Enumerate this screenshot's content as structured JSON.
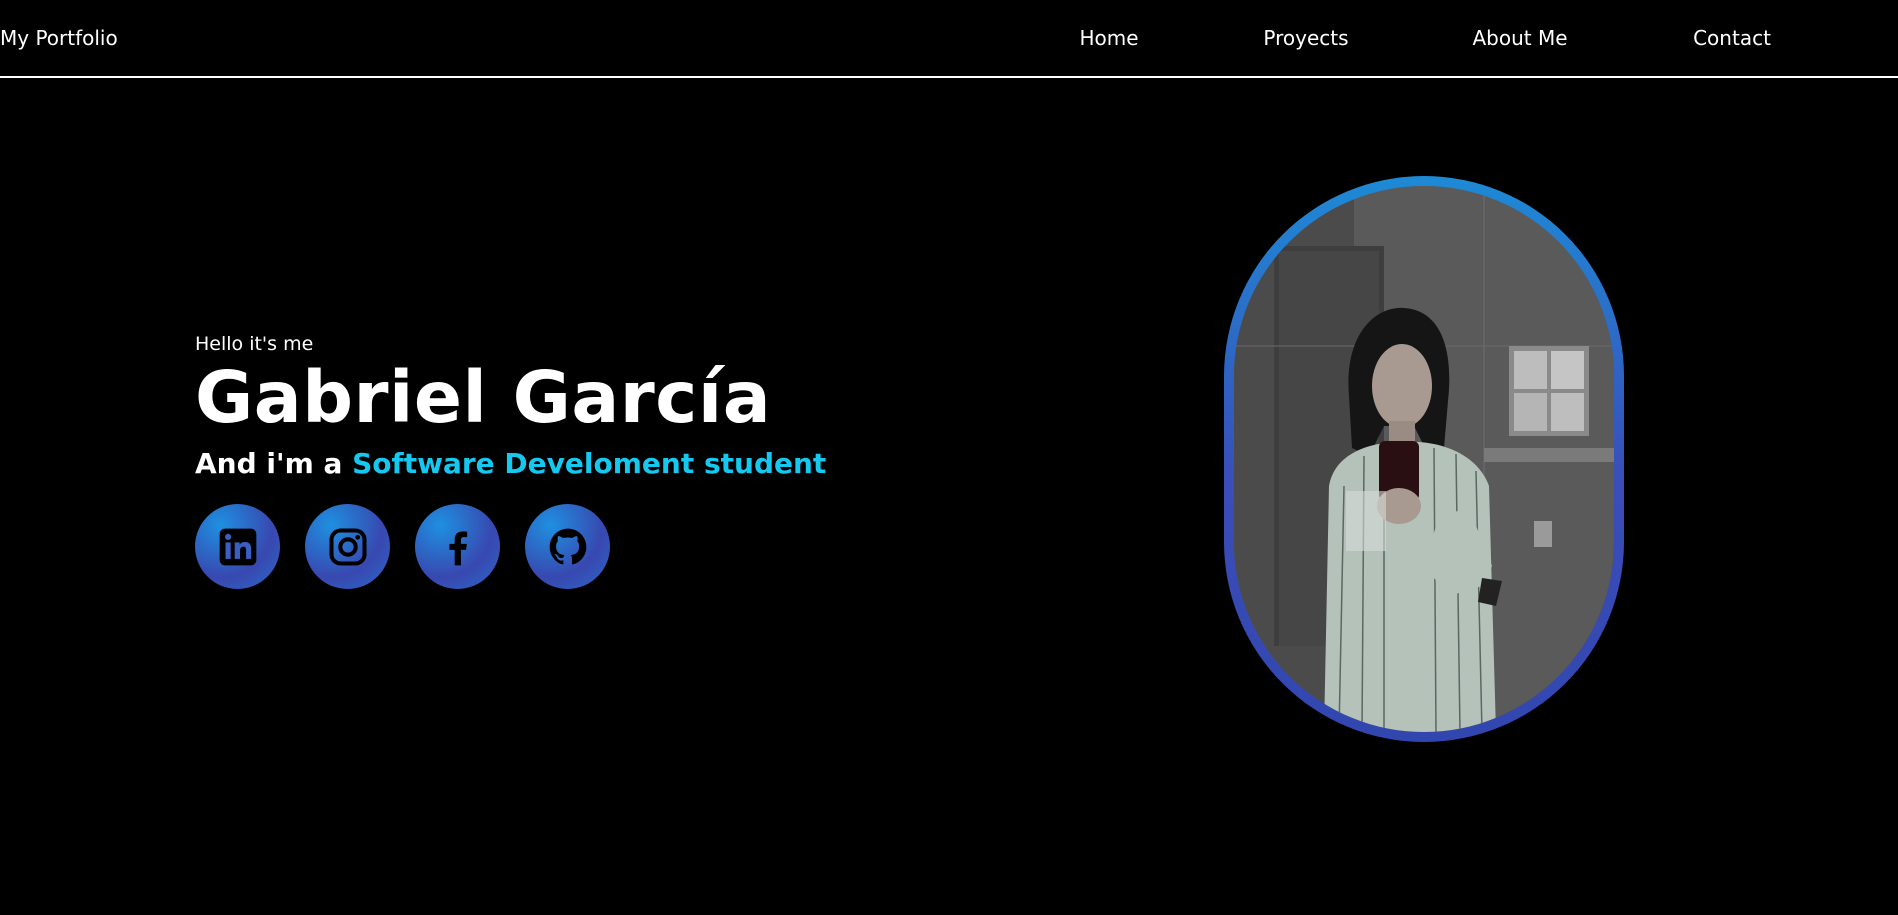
{
  "nav": {
    "brand": "My Portfolio",
    "links": [
      "Home",
      "Proyects",
      "About Me",
      "Contact"
    ]
  },
  "hero": {
    "greeting": "Hello it's me",
    "name": "Gabriel García",
    "role_prefix": "And i'm a ",
    "role_highlight": "Software Develoment student"
  },
  "socials": [
    {
      "icon": "linkedin-icon"
    },
    {
      "icon": "instagram-icon"
    },
    {
      "icon": "facebook-icon"
    },
    {
      "icon": "github-icon"
    }
  ],
  "colors": {
    "background": "#000000",
    "text": "#ffffff",
    "accent": "#14c8f0",
    "gradient_start": "#1d8ad6",
    "gradient_end": "#3a4db8"
  }
}
